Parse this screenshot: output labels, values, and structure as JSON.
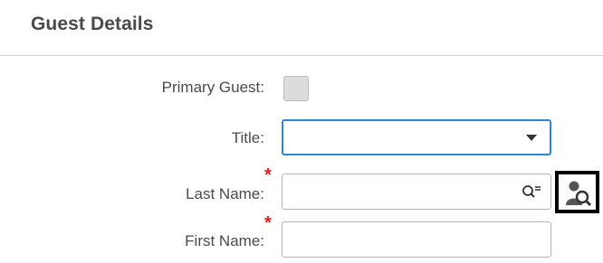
{
  "section": {
    "title": "Guest Details"
  },
  "fields": {
    "primary_guest": {
      "label": "Primary Guest:",
      "checked": false
    },
    "title": {
      "label": "Title:",
      "value": ""
    },
    "last_name": {
      "label": "Last Name:",
      "required_marker": "*",
      "value": "",
      "search_icon": "search-list-icon"
    },
    "first_name": {
      "label": "First Name:",
      "required_marker": "*",
      "value": ""
    }
  },
  "guest_lookup": {
    "icon": "person-search-icon"
  },
  "colors": {
    "focus_border": "#2f86d6",
    "required": "#e02020",
    "highlight_border": "#000000"
  }
}
